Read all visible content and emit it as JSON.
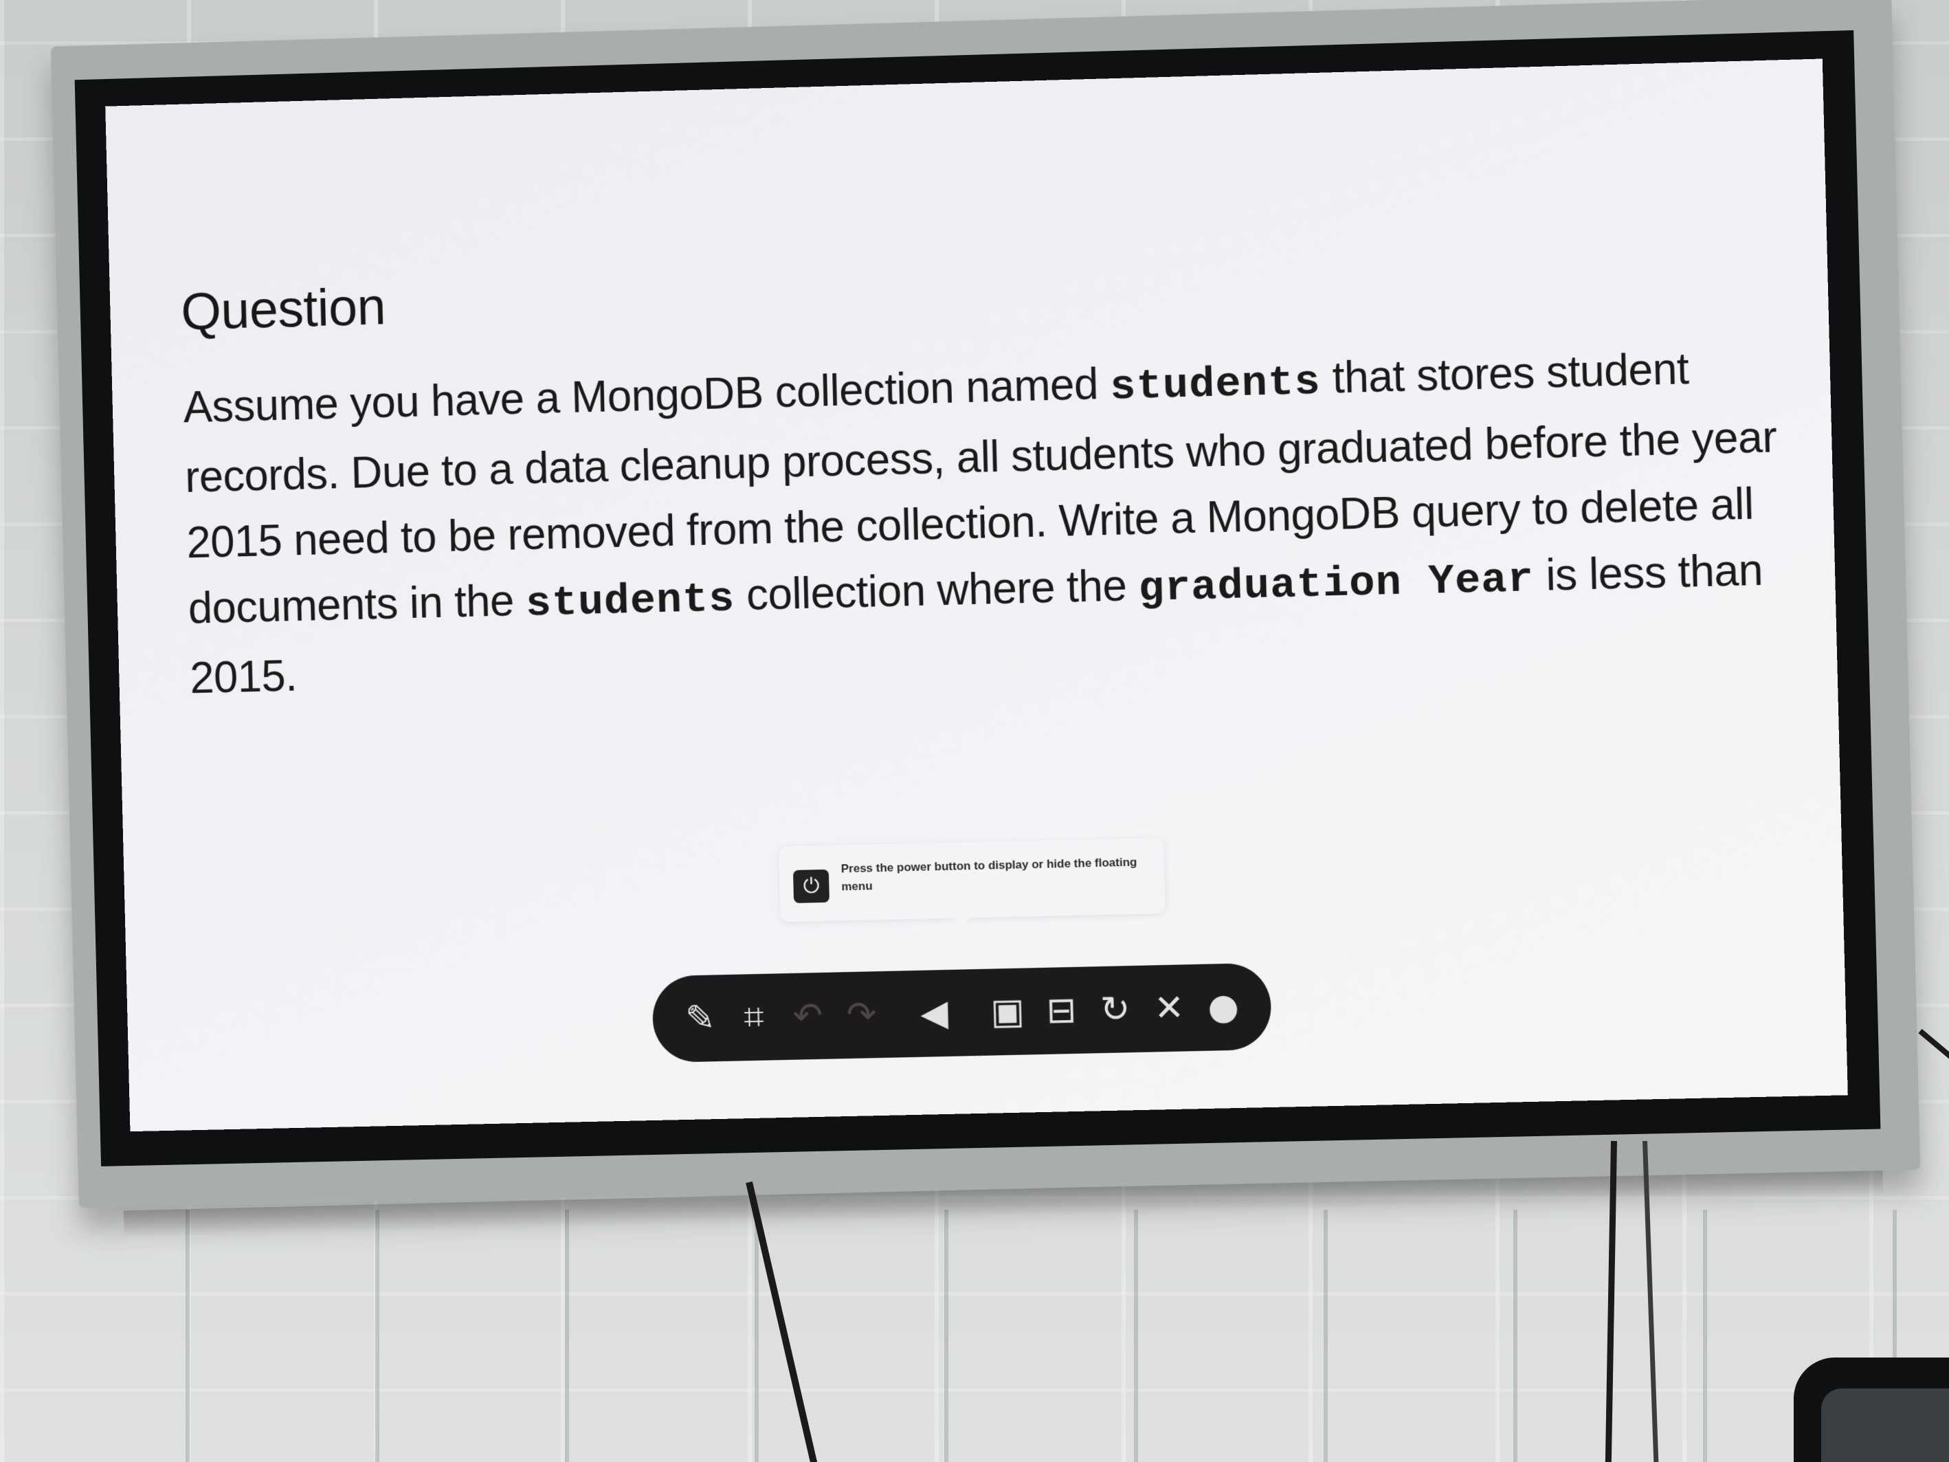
{
  "slide": {
    "title": "Question",
    "body": {
      "part1": "Assume you have a MongoDB collection named ",
      "code1": "students",
      "part2": " that stores student records. Due to a data cleanup process, all students who graduated before the year 2015 need to be removed from the collection. Write a MongoDB query to delete all documents in the ",
      "code2": "students",
      "part3": " collection where the ",
      "code3": "graduation Year",
      "part4": " is less than 2015."
    }
  },
  "tooltip": {
    "text": "Press the power button to display or hide the floating menu",
    "icon": "power-icon"
  },
  "toolbar": {
    "buttons": [
      {
        "icon": "annotate-icon",
        "glyph": "✎"
      },
      {
        "icon": "crop-icon",
        "glyph": "⌗"
      },
      {
        "icon": "undo-icon",
        "glyph": "↶"
      },
      {
        "icon": "redo-icon",
        "glyph": "↷"
      },
      {
        "icon": "volume-icon",
        "glyph": "◀"
      },
      {
        "icon": "window-icon",
        "glyph": "▣"
      },
      {
        "icon": "split-icon",
        "glyph": "⊟"
      },
      {
        "icon": "rotate-icon",
        "glyph": "↻"
      },
      {
        "icon": "close-icon",
        "glyph": "✕"
      },
      {
        "icon": "more-icon",
        "glyph": "●"
      }
    ]
  },
  "colors": {
    "screen": "#f1f2f5",
    "bezel": "#0f1011",
    "frame": "#a9adac",
    "toolbar": "#1d1a1d",
    "wall": "#d3d6d6"
  }
}
